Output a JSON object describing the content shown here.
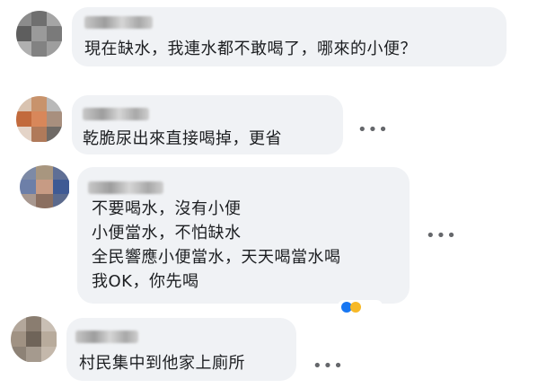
{
  "comments": [
    {
      "text_lines": [
        "現在缺水，我連水都不敢喝了，哪來的小便？"
      ],
      "more_label": ""
    },
    {
      "text_lines": [
        "乾脆尿出來直接喝掉，更省"
      ],
      "more_label": "•••"
    },
    {
      "text_lines": [
        "不要喝水，沒有小便",
        "小便當水，不怕缺水",
        "全民響應小便當水，天天喝當水喝",
        "我OK，你先喝"
      ],
      "more_label": "•••"
    },
    {
      "text_lines": [
        "村民集中到他家上廁所"
      ],
      "more_label": "•••"
    }
  ],
  "colors": {
    "bubble": "#f0f2f5",
    "text": "#1c1e21",
    "muted": "#65676b",
    "like_blue": "#1877f2",
    "haha_yellow": "#f7b928"
  }
}
